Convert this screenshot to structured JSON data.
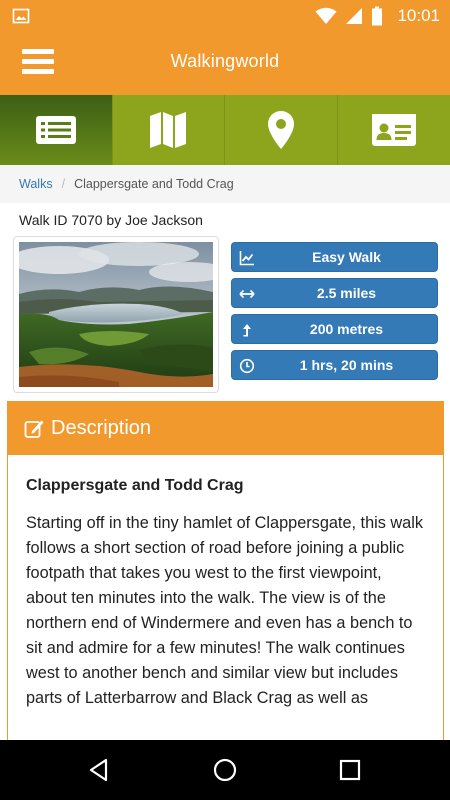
{
  "status_bar": {
    "time": "10:01",
    "icons": [
      "image-icon",
      "wifi-icon",
      "signal-icon",
      "battery-icon"
    ]
  },
  "app_bar": {
    "title": "Walkingworld",
    "menu_icon": "menu-icon"
  },
  "tabs": [
    {
      "name": "list-tab",
      "icon": "list-icon",
      "active": true
    },
    {
      "name": "map-tab",
      "icon": "map-icon",
      "active": false
    },
    {
      "name": "location-tab",
      "icon": "location-pin-icon",
      "active": false
    },
    {
      "name": "contact-card-tab",
      "icon": "id-card-icon",
      "active": false
    }
  ],
  "breadcrumb": {
    "link": "Walks",
    "separator": "/",
    "current": "Clappersgate and Todd Crag"
  },
  "walk": {
    "id_line": "Walk ID 7070 by Joe Jackson",
    "stats": [
      {
        "label": "Easy Walk",
        "icon": "trend-chart-icon"
      },
      {
        "label": "2.5 miles",
        "icon": "distance-arrows-icon"
      },
      {
        "label": "200 metres",
        "icon": "ascent-arrow-icon"
      },
      {
        "label": "1 hrs, 20 mins",
        "icon": "clock-icon"
      }
    ]
  },
  "description": {
    "heading": "Description",
    "heading_icon": "edit-icon",
    "title": "Clappersgate and Todd Crag",
    "text": "Starting off in the tiny hamlet of Clappersgate, this walk follows a short section of road before joining a public footpath that takes you west to the first viewpoint, about ten minutes into the walk. The view is of the northern end of Windermere and even has a bench to sit and admire for a few minutes! The walk continues west to another bench and similar view but includes parts of Latterbarrow and Black Crag as well as"
  },
  "colors": {
    "brand_orange": "#f2992e",
    "tab_green": "#8da51c",
    "tab_active": "#3b5e15",
    "button_blue": "#337ab7"
  }
}
